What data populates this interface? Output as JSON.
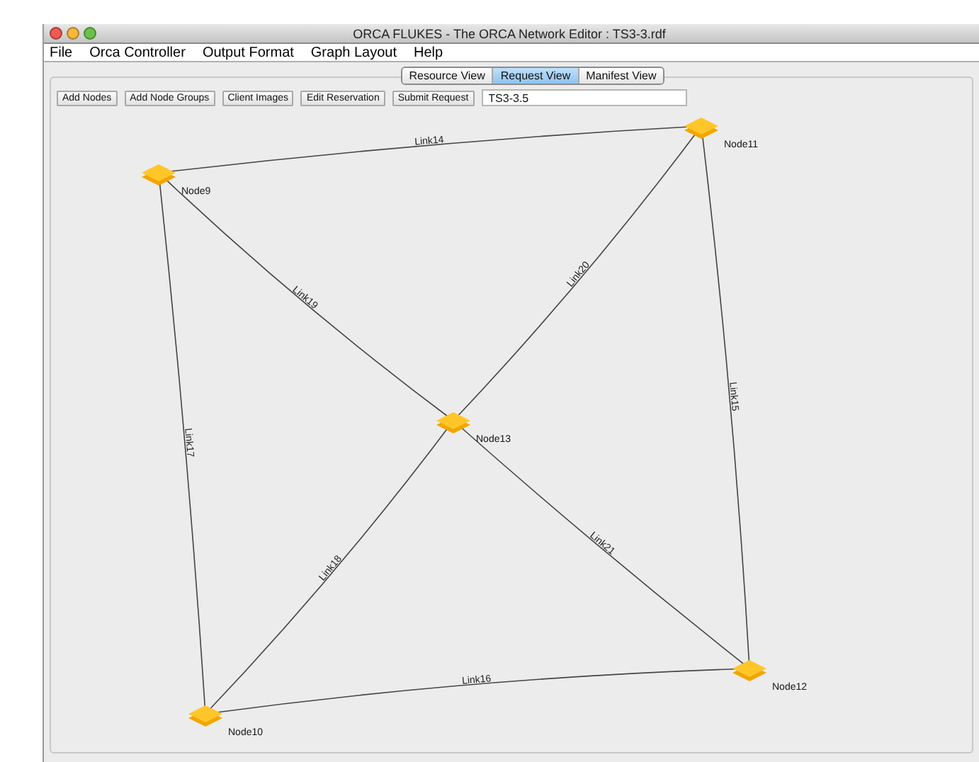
{
  "window": {
    "title": "ORCA FLUKES - The ORCA Network Editor : TS3-3.rdf"
  },
  "menu": [
    "File",
    "Orca Controller",
    "Output Format",
    "Graph Layout",
    "Help"
  ],
  "tabs": [
    {
      "label": "Resource View",
      "selected": false
    },
    {
      "label": "Request View",
      "selected": true
    },
    {
      "label": "Manifest View",
      "selected": false
    }
  ],
  "toolbar": {
    "buttons": [
      "Add Nodes",
      "Add Node Groups",
      "Client Images",
      "Edit Reservation",
      "Submit Request"
    ],
    "field": {
      "value": "TS3-3.5"
    }
  },
  "graph": {
    "nodes": [
      {
        "label": "Node9"
      },
      {
        "label": "Node11"
      },
      {
        "label": "Node13"
      },
      {
        "label": "Node10"
      },
      {
        "label": "Node12"
      }
    ],
    "links": [
      {
        "label": "Link14"
      },
      {
        "label": "Link19"
      },
      {
        "label": "Link20"
      },
      {
        "label": "Link15"
      },
      {
        "label": "Link17"
      },
      {
        "label": "Link18"
      },
      {
        "label": "Link21"
      },
      {
        "label": "Link16"
      }
    ]
  }
}
